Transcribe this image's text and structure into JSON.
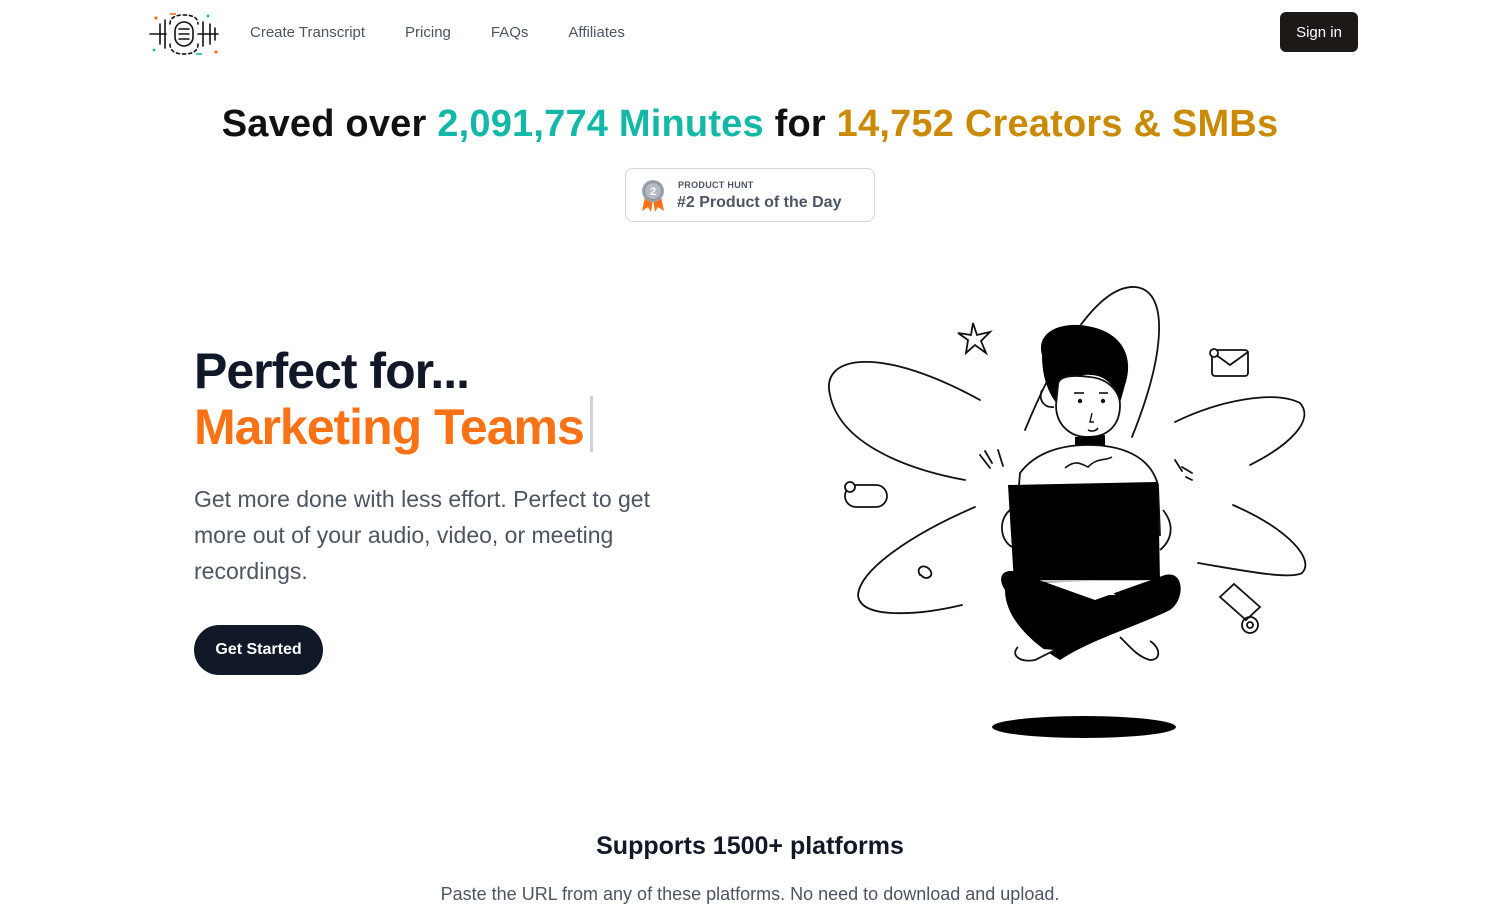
{
  "nav": {
    "items": [
      {
        "label": "Create Transcript"
      },
      {
        "label": "Pricing"
      },
      {
        "label": "FAQs"
      },
      {
        "label": "Affiliates"
      }
    ],
    "signin_label": "Sign in"
  },
  "stats": {
    "prefix": "Saved over",
    "minutes_value": "2,091,774",
    "minutes_label": "Minutes",
    "connector": "for",
    "creators_value": "14,752",
    "creators_label": "Creators & SMBs"
  },
  "product_hunt": {
    "small_label": "PRODUCT HUNT",
    "big_label": "#2 Product of the Day",
    "medal_number": "2"
  },
  "hero": {
    "line1": "Perfect for...",
    "line2": "Marketing Teams",
    "description": "Get more done with less effort. Perfect to get more out of your audio, video, or meeting recordings.",
    "cta_label": "Get Started"
  },
  "platforms": {
    "title": "Supports 1500+ platforms",
    "subtitle": "Paste the URL from any of these platforms. No need to download and upload."
  },
  "colors": {
    "teal": "#14b8a6",
    "gold": "#ca8a04",
    "orange": "#f97316",
    "dark": "#111827",
    "signin_bg": "#1c1917"
  }
}
